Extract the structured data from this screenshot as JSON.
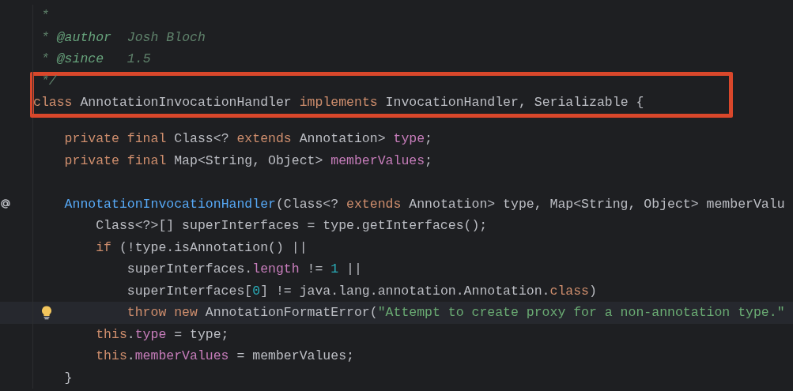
{
  "editor": {
    "lines": [
      {
        "kind": "code",
        "tokens": [
          {
            "kind": "doc",
            "text": "*"
          }
        ]
      },
      {
        "kind": "code",
        "tokens": [
          {
            "kind": "doc",
            "text": "* "
          },
          {
            "kind": "doctag",
            "text": "@author"
          },
          {
            "kind": "doc",
            "text": "  Josh Bloch"
          }
        ]
      },
      {
        "kind": "code",
        "tokens": [
          {
            "kind": "doc",
            "text": "* "
          },
          {
            "kind": "doctag",
            "text": "@since"
          },
          {
            "kind": "doc",
            "text": "   1.5"
          }
        ]
      },
      {
        "kind": "code",
        "boxed": true,
        "tokens": [
          {
            "kind": "doc",
            "text": "*/"
          }
        ]
      },
      {
        "kind": "code",
        "boxed": true,
        "tokens": [
          {
            "kind": "keyword",
            "text": "class "
          },
          {
            "kind": "plain",
            "text": "AnnotationInvocationHandler "
          },
          {
            "kind": "keyword",
            "text": "implements "
          },
          {
            "kind": "plain",
            "text": "InvocationHandler, Serializable {"
          }
        ],
        "children": [
          {
            "kind": "blank"
          },
          {
            "kind": "code",
            "tokens": [
              {
                "kind": "keyword",
                "text": "private final "
              },
              {
                "kind": "plain",
                "text": "Class<? "
              },
              {
                "kind": "keyword",
                "text": "extends "
              },
              {
                "kind": "plain",
                "text": "Annotation> "
              },
              {
                "kind": "field",
                "text": "type"
              },
              {
                "kind": "plain",
                "text": ";"
              }
            ]
          },
          {
            "kind": "code",
            "tokens": [
              {
                "kind": "keyword",
                "text": "private final "
              },
              {
                "kind": "plain",
                "text": "Map<String, Object> "
              },
              {
                "kind": "field",
                "text": "memberValues"
              },
              {
                "kind": "plain",
                "text": ";"
              }
            ]
          },
          {
            "kind": "blank"
          },
          {
            "kind": "code",
            "annotation_mark": true,
            "tokens": [
              {
                "kind": "method",
                "text": "AnnotationInvocationHandler"
              },
              {
                "kind": "plain",
                "text": "(Class<? "
              },
              {
                "kind": "keyword",
                "text": "extends "
              },
              {
                "kind": "plain",
                "text": "Annotation> type, Map<String, Object> memberValu"
              }
            ],
            "children": [
              {
                "kind": "code",
                "tokens": [
                  {
                    "kind": "plain",
                    "text": "Class<?>[] superInterfaces = type.getInterfaces();"
                  }
                ]
              },
              {
                "kind": "code",
                "tokens": [
                  {
                    "kind": "keyword",
                    "text": "if "
                  },
                  {
                    "kind": "plain",
                    "text": "(!type.isAnnotation() ||"
                  }
                ],
                "children": [
                  {
                    "kind": "code",
                    "tokens": [
                      {
                        "kind": "plain",
                        "text": "superInterfaces."
                      },
                      {
                        "kind": "field",
                        "text": "length"
                      },
                      {
                        "kind": "plain",
                        "text": " != "
                      },
                      {
                        "kind": "number",
                        "text": "1"
                      },
                      {
                        "kind": "plain",
                        "text": " ||"
                      }
                    ]
                  },
                  {
                    "kind": "code",
                    "tokens": [
                      {
                        "kind": "plain",
                        "text": "superInterfaces["
                      },
                      {
                        "kind": "number",
                        "text": "0"
                      },
                      {
                        "kind": "plain",
                        "text": "] != java.lang.annotation.Annotation."
                      },
                      {
                        "kind": "keyword",
                        "text": "class"
                      },
                      {
                        "kind": "plain",
                        "text": ")"
                      }
                    ]
                  },
                  {
                    "kind": "code",
                    "current": true,
                    "bulb": true,
                    "tokens": [
                      {
                        "kind": "keyword",
                        "text": "throw new "
                      },
                      {
                        "kind": "plain",
                        "text": "AnnotationFormatError("
                      },
                      {
                        "kind": "string",
                        "text": "\"Attempt to create proxy for a non-annotation type.\""
                      }
                    ]
                  }
                ]
              },
              {
                "kind": "code",
                "tokens": [
                  {
                    "kind": "keyword",
                    "text": "this"
                  },
                  {
                    "kind": "plain",
                    "text": "."
                  },
                  {
                    "kind": "field",
                    "text": "type"
                  },
                  {
                    "kind": "plain",
                    "text": " = type;"
                  }
                ]
              },
              {
                "kind": "code",
                "tokens": [
                  {
                    "kind": "keyword",
                    "text": "this"
                  },
                  {
                    "kind": "plain",
                    "text": "."
                  },
                  {
                    "kind": "field",
                    "text": "memberValues"
                  },
                  {
                    "kind": "plain",
                    "text": " = memberValues;"
                  }
                ]
              }
            ]
          },
          {
            "kind": "code",
            "tokens": [
              {
                "kind": "plain",
                "text": "}"
              }
            ]
          }
        ]
      }
    ]
  }
}
